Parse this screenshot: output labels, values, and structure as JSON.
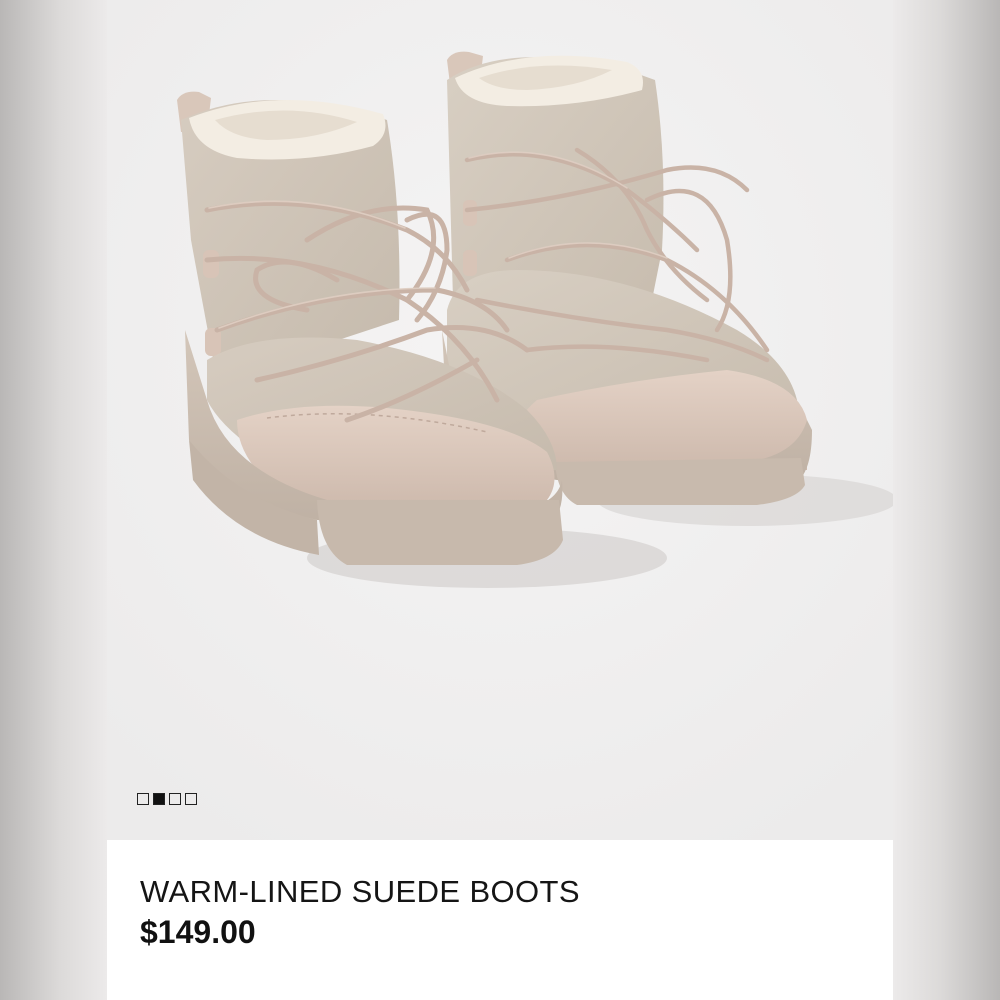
{
  "product": {
    "name": "WARM-LINED SUEDE BOOTS",
    "price": "$149.00"
  },
  "gallery": {
    "image_count": 4,
    "active_index": 1
  },
  "colors": {
    "suede": "#cfc5b9",
    "leather": "#dcc8bc",
    "shearling": "#f2ece2",
    "sole": "#cbbdb0",
    "photo_background": "#f0efef"
  }
}
